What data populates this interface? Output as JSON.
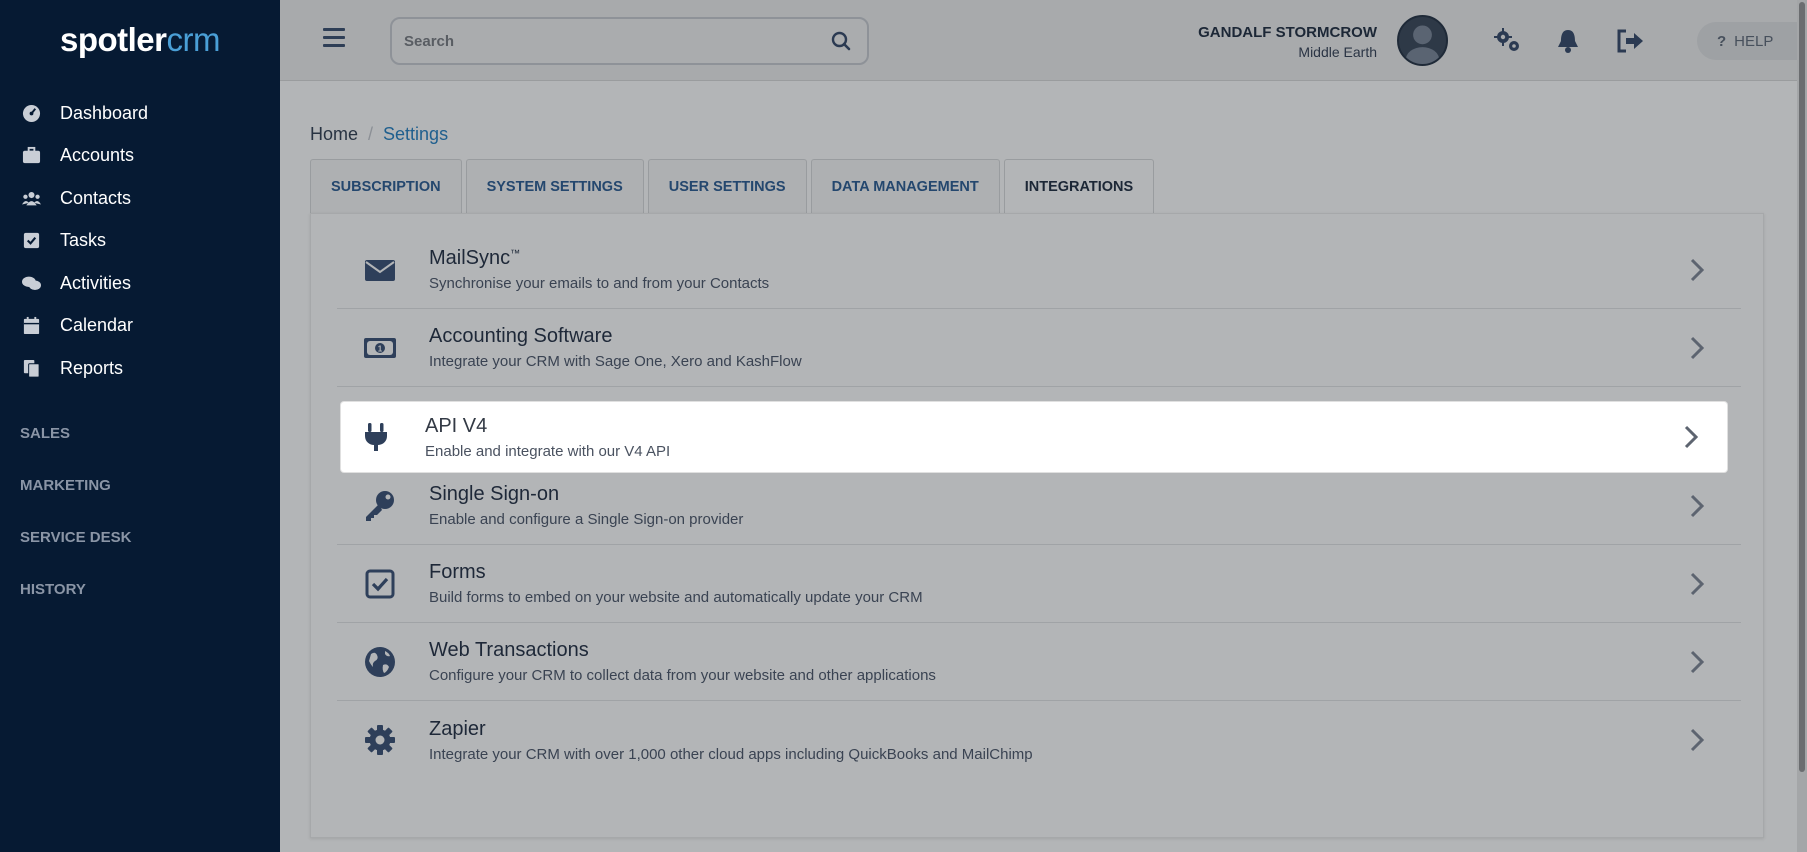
{
  "brand": {
    "part1": "spotler",
    "part2": "crm"
  },
  "sidebar": {
    "items": [
      {
        "label": "Dashboard",
        "icon": "dashboard-icon"
      },
      {
        "label": "Accounts",
        "icon": "briefcase-icon"
      },
      {
        "label": "Contacts",
        "icon": "users-icon"
      },
      {
        "label": "Tasks",
        "icon": "checkbox-icon"
      },
      {
        "label": "Activities",
        "icon": "comments-icon"
      },
      {
        "label": "Calendar",
        "icon": "calendar-icon"
      },
      {
        "label": "Reports",
        "icon": "copy-icon"
      }
    ],
    "sections": [
      "SALES",
      "MARKETING",
      "SERVICE DESK",
      "HISTORY"
    ]
  },
  "topbar": {
    "search_placeholder": "Search",
    "user_name": "GANDALF STORMCROW",
    "user_location": "Middle Earth",
    "help_label": "HELP",
    "help_mark": "?"
  },
  "breadcrumb": {
    "home": "Home",
    "separator": "/",
    "current": "Settings"
  },
  "tabs": [
    {
      "label": "SUBSCRIPTION"
    },
    {
      "label": "SYSTEM SETTINGS"
    },
    {
      "label": "USER SETTINGS"
    },
    {
      "label": "DATA MANAGEMENT"
    },
    {
      "label": "INTEGRATIONS",
      "active": true
    }
  ],
  "integrations": [
    {
      "title": "MailSync",
      "tm": "™",
      "desc": "Synchronise your emails to and from your Contacts",
      "icon": "envelope-icon"
    },
    {
      "title": "Accounting Software",
      "desc": "Integrate your CRM with Sage One, Xero and KashFlow",
      "icon": "money-bill-icon"
    },
    {
      "title": "API V4",
      "desc": "Enable and integrate with our V4 API",
      "icon": "plug-icon",
      "highlighted": true
    },
    {
      "title": "Single Sign-on",
      "desc": "Enable and configure a Single Sign-on provider",
      "icon": "key-icon"
    },
    {
      "title": "Forms",
      "desc": "Build forms to embed on your website and automatically update your CRM",
      "icon": "check-square-icon"
    },
    {
      "title": "Web Transactions",
      "desc": "Configure your CRM to collect data from your website and other applications",
      "icon": "globe-icon"
    },
    {
      "title": "Zapier",
      "desc": "Integrate your CRM with over 1,000 other cloud apps including QuickBooks and MailChimp",
      "icon": "gear-icon"
    }
  ],
  "colors": {
    "sidebar_bg": "#061a33",
    "brand_accent": "#4a9fd6",
    "link": "#1f5f8e"
  }
}
